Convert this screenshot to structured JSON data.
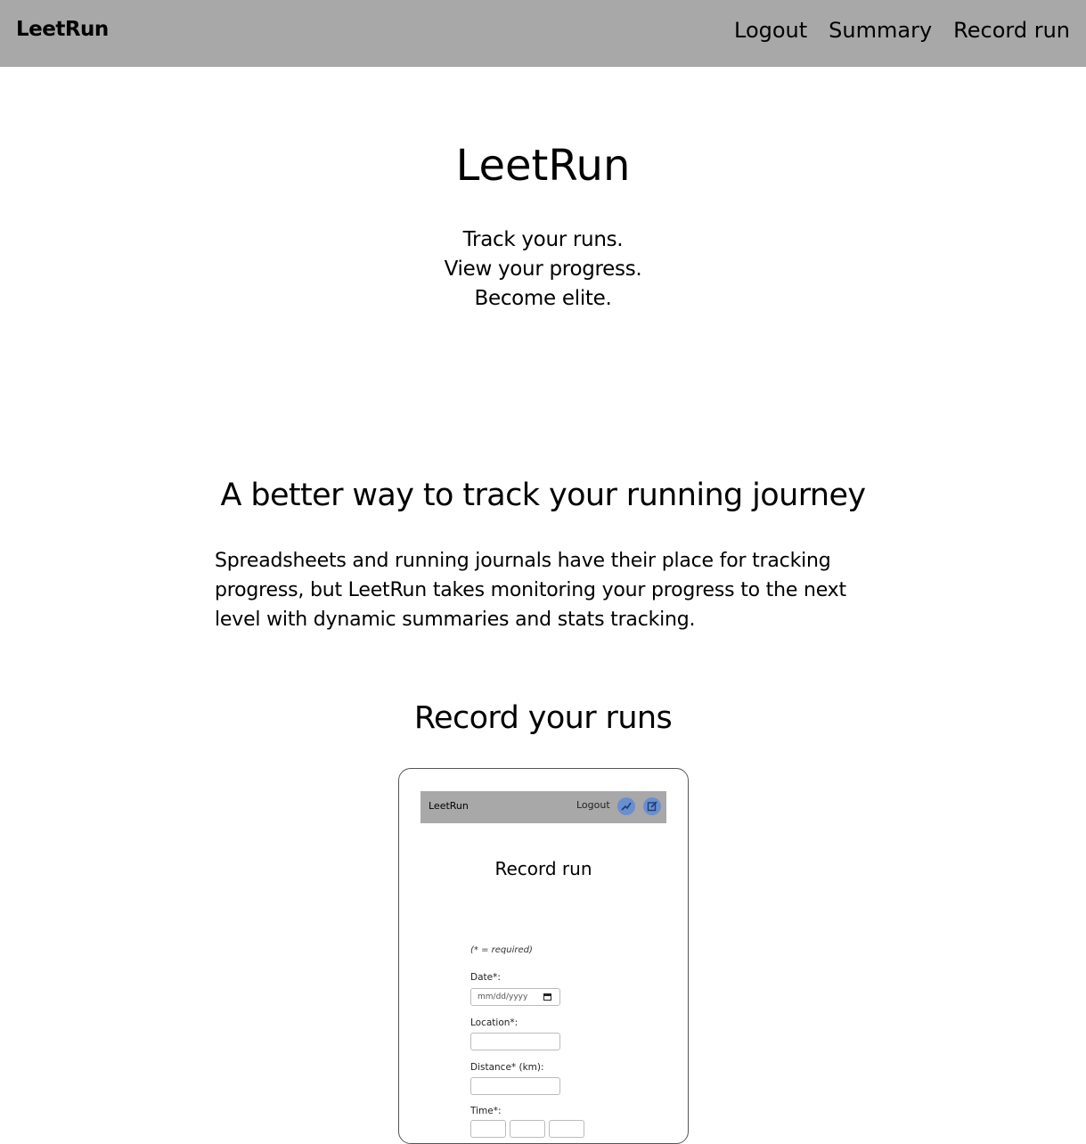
{
  "navbar": {
    "brand": "LeetRun",
    "links": [
      "Logout",
      "Summary",
      "Record run"
    ]
  },
  "hero": {
    "title": "LeetRun",
    "tagline": [
      "Track your runs.",
      "View your progress.",
      "Become elite."
    ]
  },
  "intro": {
    "heading": "A better way to track your running journey",
    "body": "Spreadsheets and running journals have their place for tracking progress, but LeetRun takes monitoring your progress to the next level with dynamic summaries and stats tracking."
  },
  "record_section": {
    "heading": "Record your runs"
  },
  "preview": {
    "brand": "LeetRun",
    "logout": "Logout",
    "icons": [
      "chart-icon",
      "edit-icon"
    ],
    "title": "Record run",
    "note": "(* = required)",
    "fields": {
      "date_label": "Date*:",
      "date_placeholder": "mm/dd/yyyy",
      "location_label": "Location*:",
      "distance_label": "Distance* (km):",
      "time_label": "Time*:"
    }
  },
  "colors": {
    "navbar_bg": "#a8a8a8",
    "icon_bg": "#6a8fcf"
  }
}
